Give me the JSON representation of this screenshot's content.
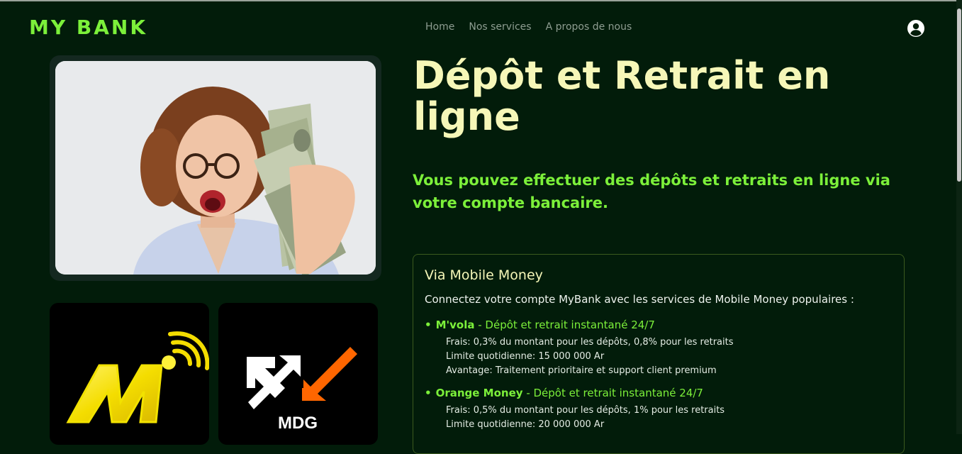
{
  "brand": "MY BANK",
  "nav": {
    "home": "Home",
    "services": "Nos services",
    "about": "A propos de nous"
  },
  "hero": {
    "title": "Dépôt et Retrait en ligne",
    "subtitle": "Vous pouvez effectuer des dépôts et retraits en ligne via votre compte bancaire."
  },
  "logos": {
    "orange_caption": "MDG"
  },
  "panel": {
    "title": "Via Mobile Money",
    "intro": "Connectez votre compte MyBank avec les services de Mobile Money populaires :",
    "services": [
      {
        "bullet": "•",
        "name": "M'vola",
        "separator": " - ",
        "description": "Dépôt et retrait instantané 24/7",
        "fees": "Frais: 0,3% du montant pour les dépôts, 0,8% pour les retraits",
        "limit": "Limite quotidienne: 15 000 000 Ar",
        "advantage": "Avantage: Traitement prioritaire et support client premium"
      },
      {
        "bullet": "•",
        "name": "Orange Money",
        "separator": " - ",
        "description": "Dépôt et retrait instantané 24/7",
        "fees": "Frais: 0,5% du montant pour les dépôts, 1% pour les retraits",
        "limit": "Limite quotidienne: 20 000 000 Ar"
      }
    ]
  },
  "colors": {
    "background": "#021c0a",
    "accent_green": "#7cf03a",
    "title_yellow": "#f6f7b8",
    "nav_gray": "#8e9d91"
  },
  "icons": {
    "user": "user-circle-icon",
    "mvola_logo": "mvola-logo",
    "orange_logo": "orange-money-logo"
  }
}
